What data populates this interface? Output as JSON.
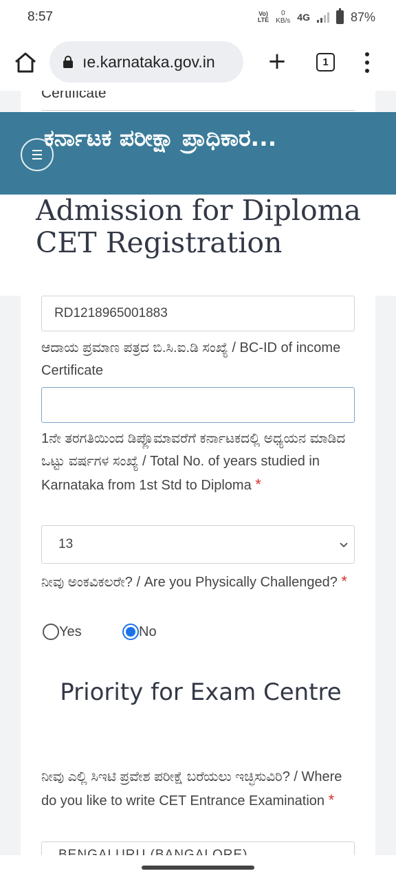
{
  "status": {
    "time": "8:57",
    "volte": "Vo)\nLTE",
    "speed_value": "0",
    "speed_unit": "KB/s",
    "network": "4G",
    "battery": "87%"
  },
  "browser": {
    "url": "ıe.karnataka.gov.in",
    "tab_count": "1"
  },
  "banner": {
    "title": "ಕರ್ನಾಟಕ ಪರೀಕ್ಷಾ ಪ್ರಾಧಿಕಾರ..."
  },
  "page": {
    "peek_label": "Certificate",
    "title": "Admission for Diploma CET Registration"
  },
  "form": {
    "rd_value": "RD1218965001883",
    "bcid_label": "ಆದಾಯ ಪ್ರಮಾಣ ಪತ್ರದ ಬಿ.ಸಿ.ಐ.ಡಿ ಸಂಖ್ಯೆ / BC-ID of income Certificate",
    "bcid_value": "",
    "years_label": "1ನೇ ತರಗತಿಯಿಂದ ಡಿಪ್ಲೊಮಾವರೆಗೆ ಕರ್ನಾಟಕದಲ್ಲಿ ಅಧ್ಯಯನ ಮಾಡಿದ ಒಟ್ಟು ವರ್ಷಗಳ ಸಂಖ್ಯೆ / Total No. of years studied in Karnataka from 1st Std to Diploma",
    "years_value": "13",
    "challenged_label": "ನೀವು ಅಂಕವಿಕಲರೇ? / Are you Physically Challenged?",
    "required_mark": "*",
    "yes_label": "Yes",
    "no_label": "No",
    "priority_heading": "Priority for Exam Centre",
    "where_label": "ನೀವು ಎಲ್ಲಿ ಸಿಇಟಿ ಪ್ರವೇಶ ಪರೀಕ್ಷೆ ಬರೆಯಲು ಇಚ್ಛಿಸುವಿರಿ? / Where do you like to write CET Entrance Examination",
    "where_value": "BENGALURU (BANGALORE)"
  },
  "colors": {
    "banner": "#3b7b99",
    "radio_checked": "#1a73e8",
    "required": "#d9302c"
  }
}
